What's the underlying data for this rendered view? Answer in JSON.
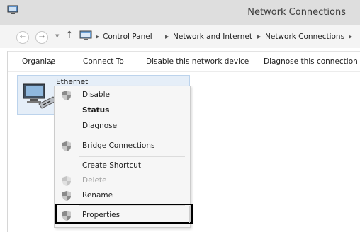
{
  "window": {
    "title": "Network Connections"
  },
  "breadcrumbs": [
    "Control Panel",
    "Network and Internet",
    "Network Connections"
  ],
  "toolbar": {
    "organize": "Organize",
    "connect_to": "Connect To",
    "disable": "Disable this network device",
    "diagnose": "Diagnose this connection"
  },
  "connection": {
    "name": "Ethernet"
  },
  "context_menu": {
    "items": [
      {
        "label": "Disable",
        "icon": "shield-icon"
      },
      {
        "label": "Status",
        "bold": true
      },
      {
        "label": "Diagnose"
      },
      {
        "label": "Bridge Connections",
        "icon": "shield-icon"
      },
      {
        "label": "Create Shortcut"
      },
      {
        "label": "Delete",
        "icon": "shield-icon",
        "disabled": true
      },
      {
        "label": "Rename",
        "icon": "shield-icon"
      },
      {
        "label": "Properties",
        "icon": "shield-icon",
        "highlighted": true
      }
    ]
  },
  "colors": {
    "selection": "#e5eef8",
    "titlebar": "#dedede",
    "highlight_border": "#000000"
  }
}
